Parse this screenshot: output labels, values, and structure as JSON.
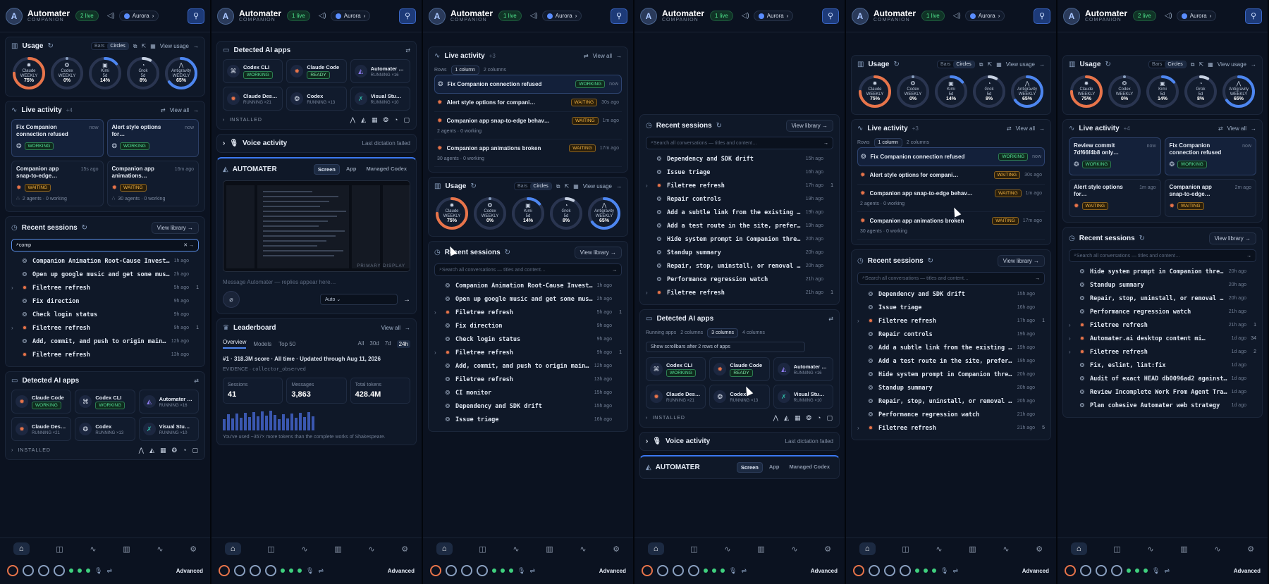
{
  "header": {
    "brand": "Automater",
    "brand_sub": "COMPANION",
    "live_badges": [
      "2 live",
      "1 live",
      "1 live",
      "1 live",
      "1 live",
      "2 live"
    ],
    "volume_icon": "speaker-icon",
    "profile": "Aurora",
    "pin_icon": "pin-icon"
  },
  "colors": {
    "accent": "#3b78f0",
    "working": "#55e39a",
    "waiting": "#f4b545",
    "claude": "#e8744a"
  },
  "usage": {
    "title": "Usage",
    "toggle": [
      "Bars",
      "Circles"
    ],
    "view": "View usage",
    "rings": [
      {
        "name": "Claude",
        "sub": "WEEKLY",
        "value": "75%",
        "pct": 75,
        "color": "#e8744a"
      },
      {
        "name": "Codex",
        "sub": "WEEKLY",
        "value": "0%",
        "pct": 0,
        "color": "#8aa0c0"
      },
      {
        "name": "Kimi",
        "sub": "5d",
        "value": "14%",
        "pct": 14,
        "color": "#4d86f0"
      },
      {
        "name": "Grok",
        "sub": "5d",
        "value": "8%",
        "pct": 8,
        "color": "#c8d2e2"
      },
      {
        "name": "Antigravity",
        "sub": "WEEKLY",
        "value": "65%",
        "pct": 65,
        "color": "#4d86f0"
      }
    ]
  },
  "live": {
    "title": "Live activity",
    "counts": [
      "+4",
      "+3",
      "+3",
      "+4"
    ],
    "view": "View all",
    "rows_label": "Rows",
    "row_opts": [
      "1 column",
      "2 columns"
    ],
    "tiles_c1": [
      {
        "title": "Fix Companion connection refused",
        "time": "now",
        "badge": "WORKING",
        "foot": ""
      },
      {
        "title": "Alert style options for…",
        "time": "now",
        "badge": "WORKING",
        "foot": ""
      },
      {
        "title": "Companion app snap-to-edge…",
        "time": "15s ago",
        "badge": "WAITING",
        "foot": "2 agents · 0 working"
      },
      {
        "title": "Companion app animations…",
        "time": "16m ago",
        "badge": "WAITING",
        "foot": "30 agents · 0 working"
      }
    ],
    "rows": [
      {
        "title": "Fix Companion connection refused",
        "badge": "WORKING",
        "time": "now",
        "sub": ""
      },
      {
        "title": "Alert style options for compani…",
        "badge": "WAITING",
        "time": "30s ago",
        "sub": ""
      },
      {
        "title": "Companion app snap-to-edge behav…",
        "badge": "WAITING",
        "time": "1m ago",
        "sub": "2 agents · 0 working"
      },
      {
        "title": "Companion app animations broken",
        "badge": "WAITING",
        "time": "17m ago",
        "sub": "30 agents · 0 working"
      }
    ],
    "tiles_c6": [
      {
        "title": "Review commit 7df66f4b8 only…",
        "time": "now",
        "badge": "WORKING",
        "foot": ""
      },
      {
        "title": "Fix Companion connection refused",
        "time": "now",
        "badge": "WORKING",
        "foot": ""
      },
      {
        "title": "Alert style options for…",
        "time": "1m ago",
        "badge": "WAITING",
        "foot": ""
      },
      {
        "title": "Companion app snap-to-edge…",
        "time": "2m ago",
        "badge": "WAITING",
        "foot": ""
      }
    ]
  },
  "sessions": {
    "title": "Recent sessions",
    "view": "View library",
    "search_value": "comp",
    "placeholder": "Search all conversations — titles and content…",
    "list_c1": [
      {
        "title": "Companion Animation Root-Cause Investi…",
        "time": "1h ago",
        "count": "",
        "sub": false,
        "chev": false
      },
      {
        "title": "Open up google music and get some musi…",
        "time": "2h ago",
        "count": "",
        "sub": false,
        "chev": false
      },
      {
        "title": "Filetree refresh",
        "time": "5h ago",
        "count": "1",
        "sub": true,
        "chev": true
      },
      {
        "title": "Fix direction",
        "time": "9h ago",
        "count": "",
        "sub": false,
        "chev": false
      },
      {
        "title": "Check login status",
        "time": "9h ago",
        "count": "",
        "sub": false,
        "chev": false
      },
      {
        "title": "Filetree refresh",
        "time": "9h ago",
        "count": "1",
        "sub": true,
        "chev": true
      },
      {
        "title": "Add, commit, and push to origin main …",
        "time": "12h ago",
        "count": "",
        "sub": false,
        "chev": false
      },
      {
        "title": "Filetree refresh",
        "time": "13h ago",
        "count": "",
        "sub": true,
        "chev": false
      }
    ],
    "list_c3": [
      {
        "title": "Companion Animation Root-Cause Investi…",
        "time": "1h ago",
        "count": "",
        "sub": false,
        "chev": false
      },
      {
        "title": "Open up google music and get some musi…",
        "time": "2h ago",
        "count": "",
        "sub": false,
        "chev": false
      },
      {
        "title": "Filetree refresh",
        "time": "5h ago",
        "count": "1",
        "sub": true,
        "chev": true
      },
      {
        "title": "Fix direction",
        "time": "9h ago",
        "count": "",
        "sub": false,
        "chev": false
      },
      {
        "title": "Check login status",
        "time": "9h ago",
        "count": "",
        "sub": false,
        "chev": false
      },
      {
        "title": "Filetree refresh",
        "time": "9h ago",
        "count": "1",
        "sub": true,
        "chev": true
      },
      {
        "title": "Add, commit, and push to origin main …",
        "time": "12h ago",
        "count": "",
        "sub": false,
        "chev": false
      },
      {
        "title": "Filetree refresh",
        "time": "13h ago",
        "count": "",
        "sub": false,
        "chev": false
      },
      {
        "title": "CI monitor",
        "time": "15h ago",
        "count": "",
        "sub": false,
        "chev": false
      },
      {
        "title": "Dependency and SDK drift",
        "time": "15h ago",
        "count": "",
        "sub": false,
        "chev": false
      },
      {
        "title": "Issue triage",
        "time": "16h ago",
        "count": "",
        "sub": false,
        "chev": false
      }
    ],
    "list_c4": [
      {
        "title": "Dependency and SDK drift",
        "time": "15h ago",
        "count": "",
        "sub": false,
        "chev": false
      },
      {
        "title": "Issue triage",
        "time": "16h ago",
        "count": "",
        "sub": false,
        "chev": false
      },
      {
        "title": "Filetree refresh",
        "time": "17h ago",
        "count": "1",
        "sub": true,
        "chev": true
      },
      {
        "title": "Repair controls",
        "time": "19h ago",
        "count": "",
        "sub": false,
        "chev": false
      },
      {
        "title": "Add a subtle link from the existing d…",
        "time": "19h ago",
        "count": "",
        "sub": false,
        "chev": false
      },
      {
        "title": "Add a test route in the site, prefera…",
        "time": "19h ago",
        "count": "",
        "sub": false,
        "chev": false
      },
      {
        "title": "Hide system prompt in Companion threa…",
        "time": "20h ago",
        "count": "",
        "sub": false,
        "chev": false
      },
      {
        "title": "Standup summary",
        "time": "20h ago",
        "count": "",
        "sub": false,
        "chev": false
      },
      {
        "title": "Repair, stop, uninstall, or removal c…",
        "time": "20h ago",
        "count": "",
        "sub": false,
        "chev": false
      },
      {
        "title": "Performance regression watch",
        "time": "21h ago",
        "count": "",
        "sub": false,
        "chev": false
      },
      {
        "title": "Filetree refresh",
        "time": "21h ago",
        "count": "1",
        "sub": true,
        "chev": true
      }
    ],
    "list_c5": [
      {
        "title": "Dependency and SDK drift",
        "time": "15h ago",
        "count": "",
        "sub": false,
        "chev": false
      },
      {
        "title": "Issue triage",
        "time": "16h ago",
        "count": "",
        "sub": false,
        "chev": false
      },
      {
        "title": "Filetree refresh",
        "time": "17h ago",
        "count": "1",
        "sub": true,
        "chev": true
      },
      {
        "title": "Repair controls",
        "time": "19h ago",
        "count": "",
        "sub": false,
        "chev": false
      },
      {
        "title": "Add a subtle link from the existing d…",
        "time": "19h ago",
        "count": "",
        "sub": false,
        "chev": false
      },
      {
        "title": "Add a test route in the site, prefera…",
        "time": "19h ago",
        "count": "",
        "sub": false,
        "chev": false
      },
      {
        "title": "Hide system prompt in Companion threa…",
        "time": "20h ago",
        "count": "",
        "sub": false,
        "chev": false
      },
      {
        "title": "Standup summary",
        "time": "20h ago",
        "count": "",
        "sub": false,
        "chev": false
      },
      {
        "title": "Repair, stop, uninstall, or removal c…",
        "time": "20h ago",
        "count": "",
        "sub": false,
        "chev": false
      },
      {
        "title": "Performance regression watch",
        "time": "21h ago",
        "count": "",
        "sub": false,
        "chev": false
      },
      {
        "title": "Filetree refresh",
        "time": "21h ago",
        "count": "5",
        "sub": true,
        "chev": true
      }
    ],
    "list_c6": [
      {
        "title": "Hide system prompt in Companion threa…",
        "time": "20h ago",
        "count": "",
        "sub": false,
        "chev": false
      },
      {
        "title": "Standup summary",
        "time": "20h ago",
        "count": "",
        "sub": false,
        "chev": false
      },
      {
        "title": "Repair, stop, uninstall, or removal c…",
        "time": "20h ago",
        "count": "",
        "sub": false,
        "chev": false
      },
      {
        "title": "Performance regression watch",
        "time": "21h ago",
        "count": "",
        "sub": false,
        "chev": false
      },
      {
        "title": "Filetree refresh",
        "time": "21h ago",
        "count": "1",
        "sub": true,
        "chev": true
      },
      {
        "title": "Automater.ai desktop content mi…",
        "time": "1d ago",
        "count": "34",
        "sub": true,
        "chev": true
      },
      {
        "title": "Filetree refresh",
        "time": "1d ago",
        "count": "2",
        "sub": true,
        "chev": true
      },
      {
        "title": "Fix, eslint, lint:fix",
        "time": "1d ago",
        "count": "",
        "sub": false,
        "chev": false
      },
      {
        "title": "Audit of exact HEAD db0096ad2 against …",
        "time": "1d ago",
        "count": "",
        "sub": false,
        "chev": false
      },
      {
        "title": "Review Incomplete Work From Agent Tran…",
        "time": "1d ago",
        "count": "",
        "sub": false,
        "chev": false
      },
      {
        "title": "Plan cohesive Automater web strategy",
        "time": "1d ago",
        "count": "",
        "sub": false,
        "chev": false
      }
    ]
  },
  "apps": {
    "title": "Detected AI apps",
    "running_label": "Running apps",
    "cols": [
      "2 columns",
      "3 columns",
      "4 columns"
    ],
    "scroll_note": "Show scrollbars after 2 rows of apps",
    "installed": "INSTALLED",
    "list": [
      {
        "name": "Codex CLI",
        "status": "WORKING",
        "icon": "⌘"
      },
      {
        "name": "Claude Code",
        "status": "READY",
        "icon": "✹"
      },
      {
        "name": "Automater …",
        "status": "RUNNING ×16",
        "icon": "◭"
      },
      {
        "name": "Claude Des…",
        "status": "RUNNING ×21",
        "icon": "✹"
      },
      {
        "name": "Codex",
        "status": "RUNNING ×13",
        "icon": "❂"
      },
      {
        "name": "Visual Stu…",
        "status": "RUNNING ×10",
        "icon": "✗"
      }
    ],
    "list_c1": [
      {
        "name": "Claude Code",
        "status": "WORKING",
        "icon": "✹"
      },
      {
        "name": "Codex CLI",
        "status": "WORKING",
        "icon": "⌘"
      },
      {
        "name": "Automater …",
        "status": "RUNNING ×16",
        "icon": "◭"
      },
      {
        "name": "Claude Des…",
        "status": "RUNNING ×21",
        "icon": "✹"
      },
      {
        "name": "Codex",
        "status": "RUNNING ×13",
        "icon": "❂"
      },
      {
        "name": "Visual Stu…",
        "status": "RUNNING ×10",
        "icon": "✗"
      }
    ]
  },
  "voice": {
    "title": "Voice activity",
    "status": "Last dictation failed",
    "box_title": "AUTOMATER",
    "tabs": [
      "Screen",
      "App",
      "Managed Codex"
    ],
    "display": "PRIMARY DISPLAY",
    "message_placeholder": "Message Automater — replies appear here…",
    "select": "Auto"
  },
  "leaderboard": {
    "title": "Leaderboard",
    "view": "View all",
    "tabs": [
      "Overview",
      "Models",
      "Top 50"
    ],
    "ranges": [
      "All",
      "30d",
      "7d",
      "24h"
    ],
    "summary": "#1 · 318.3M score · All time · Updated through Aug 11, 2026",
    "evidence_label": "EVIDENCE",
    "evidence": "collector_observed",
    "stats": [
      {
        "k": "Sessions",
        "v": "41"
      },
      {
        "k": "Messages",
        "v": "3,863"
      },
      {
        "k": "Total tokens",
        "v": "428.4M"
      }
    ],
    "foot": "You've used ~357× more tokens than the complete works of Shakespeare."
  },
  "footer": {
    "advanced": "Advanced"
  }
}
